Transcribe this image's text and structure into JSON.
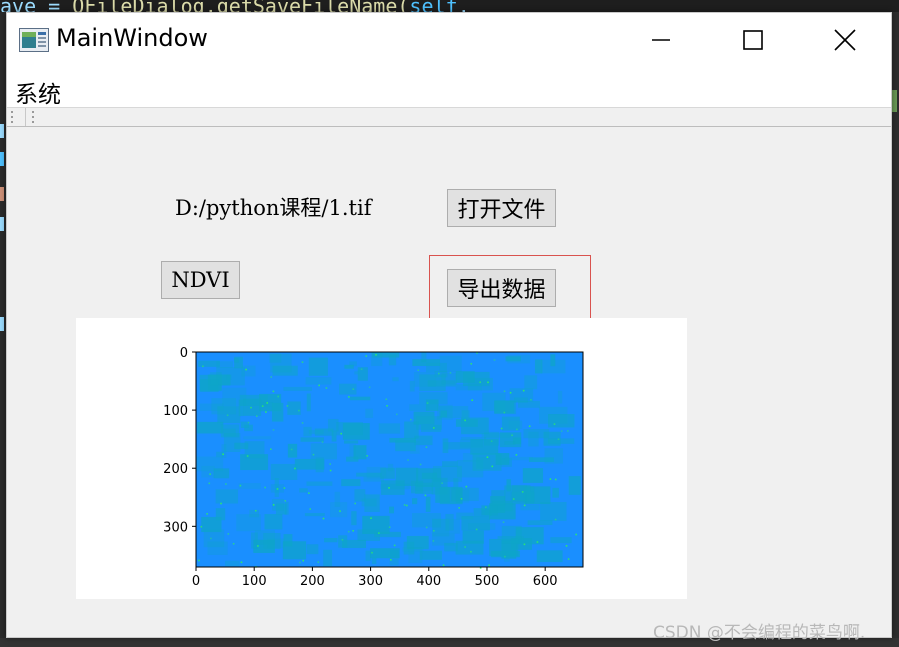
{
  "background": {
    "code_fragment": "ave = QFileDialog.getSaveFileName(self,",
    "code_parts": [
      "ave = ",
      "QFileDialog",
      ".getSaveFileName(",
      "self",
      ","
    ]
  },
  "window": {
    "title": "MainWindow",
    "controls": [
      "minimize",
      "maximize",
      "close"
    ]
  },
  "menubar": {
    "items": [
      {
        "label": "系统"
      }
    ]
  },
  "form": {
    "path_label": "D:/python课程/1.tif",
    "open_button": "打开文件",
    "ndvi_button": "NDVI",
    "export_button": "导出数据"
  },
  "chart_data": {
    "type": "heatmap",
    "title": "",
    "xlabel": "",
    "ylabel": "",
    "xlim": [
      0,
      665
    ],
    "ylim": [
      370,
      0
    ],
    "x_ticks": [
      0,
      100,
      200,
      300,
      400,
      500,
      600
    ],
    "y_ticks": [
      0,
      100,
      200,
      300
    ],
    "colormap": "jet",
    "base_color": "#1a8fff",
    "secondary_color": "#0ea5c8",
    "speckle_color": "#2ee86a"
  },
  "watermark": "CSDN @不会编程的菜鸟啊."
}
